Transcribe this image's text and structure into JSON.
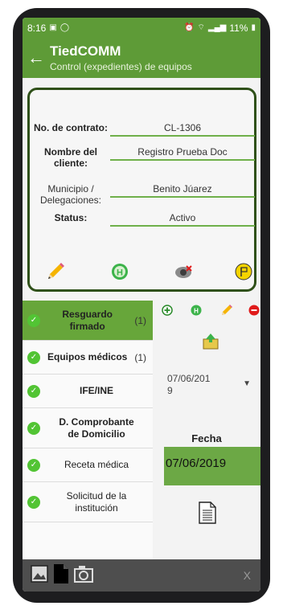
{
  "status_bar": {
    "time": "8:16",
    "battery": "11%"
  },
  "app_bar": {
    "title": "TiedCOMM",
    "subtitle": "Control (expedientes) de equipos"
  },
  "form": {
    "contrato": {
      "label": "No. de contrato:",
      "value": "CL-1306"
    },
    "cliente": {
      "label_line1": "Nombre del",
      "label_line2": "cliente:",
      "value": "Registro Prueba Doc"
    },
    "municipio": {
      "label_line1": "Municipio /",
      "label_line2": "Delegaciones:",
      "value": "Benito Júarez"
    },
    "status": {
      "label": "Status:",
      "value": "Activo"
    }
  },
  "card_actions": [
    "pencil-icon",
    "hospital-h-icon",
    "eye-cancel-icon",
    "flag-icon"
  ],
  "documents": [
    {
      "line1": "Resguardo",
      "line2": "firmado",
      "count": "(1)"
    },
    {
      "line1": "Equipos médicos",
      "line2": "",
      "count": "(1)"
    },
    {
      "line1": "IFE/INE",
      "line2": "",
      "count": ""
    },
    {
      "line1": "D. Comprobante",
      "line2": "de Domicilio",
      "count": ""
    },
    {
      "line1": "Receta médica",
      "line2": "",
      "count": ""
    },
    {
      "line1": "Solicitud de la",
      "line2": "institución",
      "count": ""
    }
  ],
  "detail": {
    "date_select": {
      "line1": "07/06/201",
      "line2": "9"
    },
    "fecha_label": "Fecha",
    "fecha_value": "07/06/2019"
  },
  "bottom_bar": {
    "close_label": "X"
  },
  "colors": {
    "primary": "#5e9b37",
    "active_item": "#67a63a",
    "check": "#52c434",
    "field_line": "#6fb04a",
    "delete": "#e01b1b"
  }
}
